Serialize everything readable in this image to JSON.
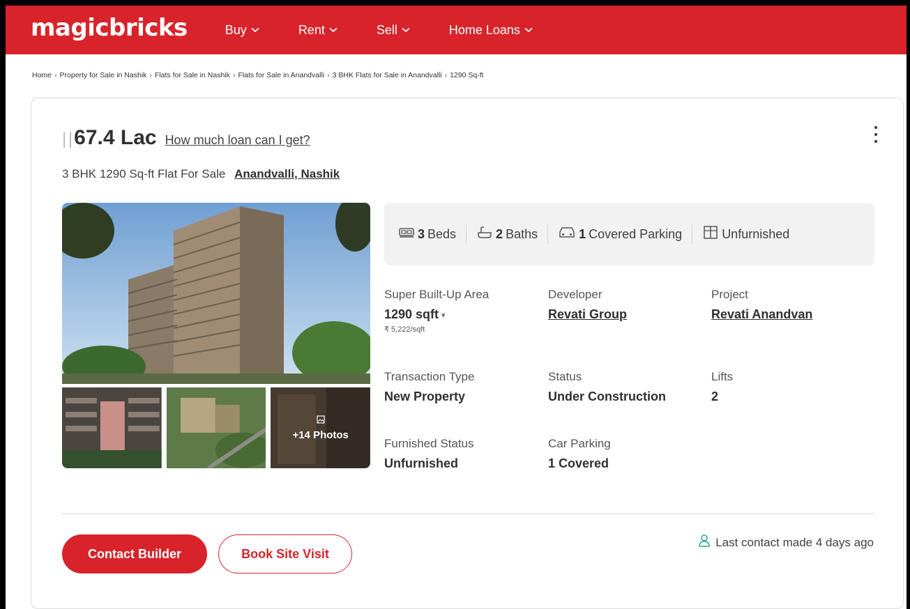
{
  "header": {
    "logo": "magicbricks",
    "nav": [
      {
        "label": "Buy"
      },
      {
        "label": "Rent"
      },
      {
        "label": "Sell"
      },
      {
        "label": "Home Loans"
      }
    ]
  },
  "breadcrumb": [
    "Home",
    "Property for Sale in Nashik",
    "Flats for Sale in Nashik",
    "Flats for Sale in Anandvalli",
    "3 BHK Flats for Sale in Anandvalli",
    "1290 Sq-ft"
  ],
  "listing": {
    "price": "67.4 Lac",
    "loan_link": "How much loan can I get?",
    "subtitle": "3 BHK 1290 Sq-ft Flat For Sale",
    "location": "Anandvalli, Nashik",
    "photos_more": "+14 Photos",
    "amenities": {
      "beds_count": "3",
      "beds_label": "Beds",
      "baths_count": "2",
      "baths_label": "Baths",
      "parking_count": "1",
      "parking_label": "Covered Parking",
      "furnishing": "Unfurnished"
    },
    "summary": {
      "area_label": "Super Built-Up Area",
      "area_value": "1290 sqft",
      "area_rate": "₹ 5,222/sqft",
      "developer_label": "Developer",
      "developer_value": "Revati Group",
      "project_label": "Project",
      "project_value": "Revati Anandvan",
      "transaction_label": "Transaction Type",
      "transaction_value": "New Property",
      "status_label": "Status",
      "status_value": "Under Construction",
      "lifts_label": "Lifts",
      "lifts_value": "2",
      "furnished_label": "Furnished Status",
      "furnished_value": "Unfurnished",
      "parking_label": "Car Parking",
      "parking_value": "1 Covered"
    },
    "actions": {
      "contact_label": "Contact Builder",
      "visit_label": "Book Site Visit",
      "last_contact": "Last contact made 4 days ago"
    }
  },
  "colors": {
    "brand_red": "#d8232a",
    "amenity_bg": "#f2f2f2",
    "last_contact_icon": "#2aa889"
  },
  "icons": [
    "chevron-down-icon",
    "kebab-menu-icon",
    "bed-icon",
    "bath-icon",
    "car-icon",
    "wardrobe-icon",
    "image-icon",
    "user-icon"
  ]
}
